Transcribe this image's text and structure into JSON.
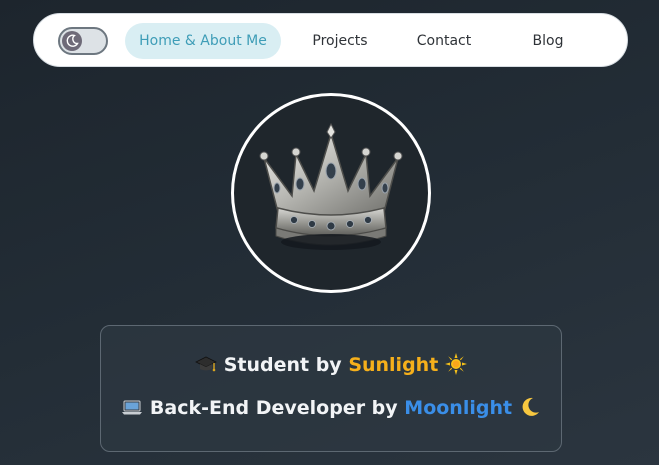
{
  "nav": {
    "theme_toggle": {
      "icon": "moon-icon",
      "state": "dark"
    },
    "items": [
      {
        "label": "Home & About Me",
        "active": true
      },
      {
        "label": "Projects",
        "active": false
      },
      {
        "label": "Contact",
        "active": false
      },
      {
        "label": "Blog",
        "active": false
      }
    ]
  },
  "avatar": {
    "icon": "crown-image"
  },
  "bio": {
    "line1": {
      "icon": "graduation-cap-icon",
      "prefix": "Student by ",
      "highlight": "Sunlight",
      "suffix_icon": "sun-icon"
    },
    "line2": {
      "icon": "laptop-icon",
      "prefix": "Back-End Developer by ",
      "highlight": "Moonlight",
      "suffix_icon": "crescent-moon-icon"
    }
  },
  "colors": {
    "accent_sun": "#f6b01b",
    "accent_moon": "#3a8ee8",
    "nav_active_bg": "#d9eef3",
    "nav_active_text": "#3e9db7"
  }
}
